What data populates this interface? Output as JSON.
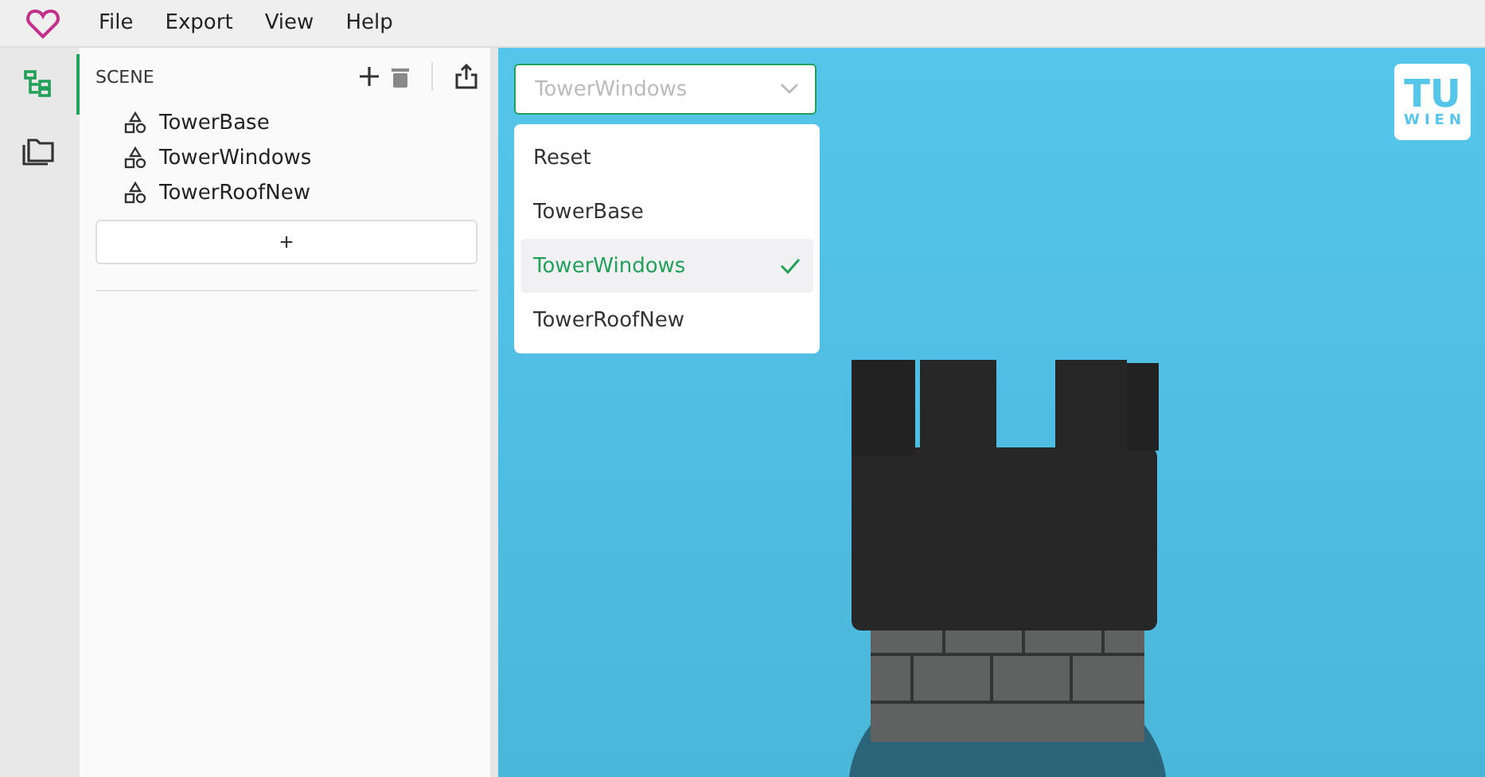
{
  "menu": [
    "File",
    "Export",
    "View",
    "Help"
  ],
  "rail": [
    {
      "kind": "scene",
      "selected": true
    },
    {
      "kind": "files",
      "selected": false
    }
  ],
  "scene": {
    "title": "SCENE",
    "items": [
      "TowerBase",
      "TowerWindows",
      "TowerRoofNew"
    ],
    "add_label": "+"
  },
  "select": {
    "placeholder": "TowerWindows",
    "options": [
      {
        "label": "Reset",
        "selected": false
      },
      {
        "label": "TowerBase",
        "selected": false
      },
      {
        "label": "TowerWindows",
        "selected": true
      },
      {
        "label": "TowerRoofNew",
        "selected": false
      }
    ]
  },
  "logo": {
    "top": "TU",
    "bottom": "WIEN"
  }
}
